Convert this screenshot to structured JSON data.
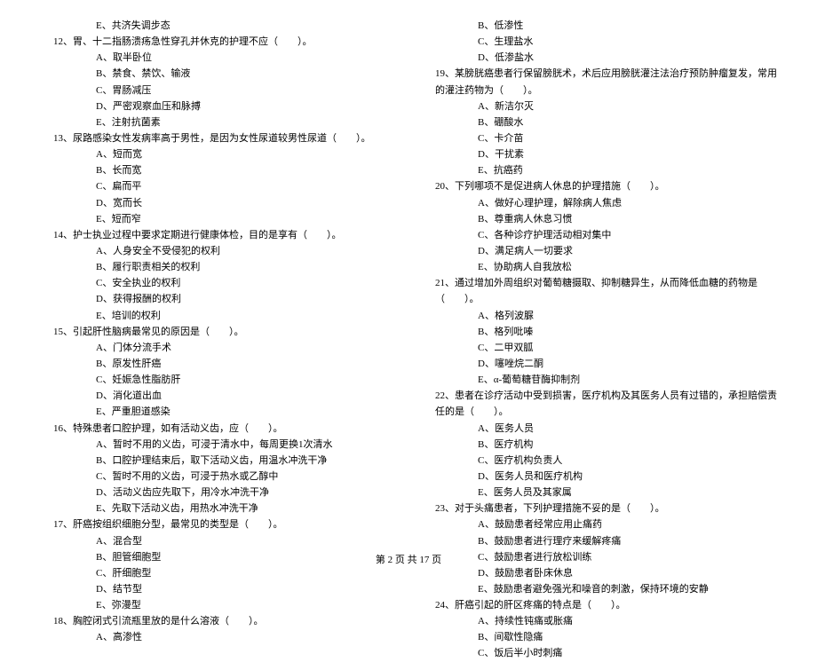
{
  "left": {
    "q11": {
      "e": "E、共济失调步态"
    },
    "q12": {
      "text": "12、胃、十二指肠溃疡急性穿孔并休克的护理不应（　　）。",
      "a": "A、取半卧位",
      "b": "B、禁食、禁饮、输液",
      "c": "C、胃肠减压",
      "d": "D、严密观察血压和脉搏",
      "e": "E、注射抗菌素"
    },
    "q13": {
      "text": "13、尿路感染女性发病率高于男性，是因为女性尿道较男性尿道（　　）。",
      "a": "A、短而宽",
      "b": "B、长而宽",
      "c": "C、扁而平",
      "d": "D、宽而长",
      "e": "E、短而窄"
    },
    "q14": {
      "text": "14、护士执业过程中要求定期进行健康体检，目的是享有（　　）。",
      "a": "A、人身安全不受侵犯的权利",
      "b": "B、履行职责相关的权利",
      "c": "C、安全执业的权利",
      "d": "D、获得报酬的权利",
      "e": "E、培训的权利"
    },
    "q15": {
      "text": "15、引起肝性脑病最常见的原因是（　　）。",
      "a": "A、门体分流手术",
      "b": "B、原发性肝癌",
      "c": "C、妊娠急性脂肪肝",
      "d": "D、消化道出血",
      "e": "E、严重胆道感染"
    },
    "q16": {
      "text": "16、特殊患者口腔护理，如有活动义齿，应（　　）。",
      "a": "A、暂时不用的义齿，可浸于清水中，每周更换1次清水",
      "b": "B、口腔护理结束后，取下活动义齿，用温水冲洗干净",
      "c": "C、暂时不用的义齿，可浸于热水或乙醇中",
      "d": "D、活动义齿应先取下，用冷水冲洗干净",
      "e": "E、先取下活动义齿，用热水冲洗干净"
    },
    "q17": {
      "text": "17、肝癌按组织细胞分型，最常见的类型是（　　）。",
      "a": "A、混合型",
      "b": "B、胆管细胞型",
      "c": "C、肝细胞型",
      "d": "D、结节型",
      "e": "E、弥漫型"
    },
    "q18": {
      "text": "18、胸腔闭式引流瓶里放的是什么溶液（　　）。",
      "a": "A、高渗性"
    }
  },
  "right": {
    "q18": {
      "b": "B、低渗性",
      "c": "C、生理盐水",
      "d": "D、低渗盐水"
    },
    "q19": {
      "text": "19、某膀胱癌患者行保留膀胱术，术后应用膀胱灌注法治疗预防肿瘤复发，常用的灌注药物为（　　）。",
      "a": "A、新洁尔灭",
      "b": "B、硼酸水",
      "c": "C、卡介苗",
      "d": "D、干扰素",
      "e": "E、抗癌药"
    },
    "q20": {
      "text": "20、下列哪项不是促进病人休息的护理措施（　　）。",
      "a": "A、做好心理护理，解除病人焦虑",
      "b": "B、尊重病人休息习惯",
      "c": "C、各种诊疗护理活动相对集中",
      "d": "D、满足病人一切要求",
      "e": "E、协助病人自我放松"
    },
    "q21": {
      "text": "21、通过增加外周组织对葡萄糖摄取、抑制糖异生，从而降低血糖的药物是（　　）。",
      "a": "A、格列波脲",
      "b": "B、格列吡嗪",
      "c": "C、二甲双胍",
      "d": "D、噻唑烷二酮",
      "e": "E、α-葡萄糖苷酶抑制剂"
    },
    "q22": {
      "text": "22、患者在诊疗活动中受到损害，医疗机构及其医务人员有过错的，承担赔偿责任的是（　　）。",
      "a": "A、医务人员",
      "b": "B、医疗机构",
      "c": "C、医疗机构负责人",
      "d": "D、医务人员和医疗机构",
      "e": "E、医务人员及其家属"
    },
    "q23": {
      "text": "23、对于头痛患者，下列护理措施不妥的是（　　）。",
      "a": "A、鼓励患者经常应用止痛药",
      "b": "B、鼓励患者进行理疗来缓解疼痛",
      "c": "C、鼓励患者进行放松训练",
      "d": "D、鼓励患者卧床休息",
      "e": "E、鼓励患者避免强光和噪音的刺激，保持环境的安静"
    },
    "q24": {
      "text": "24、肝癌引起的肝区疼痛的特点是（　　）。",
      "a": "A、持续性钝痛或胀痛",
      "b": "B、间歇性隐痛",
      "c": "C、饭后半小时刺痛"
    }
  },
  "footer": "第 2 页 共 17 页"
}
